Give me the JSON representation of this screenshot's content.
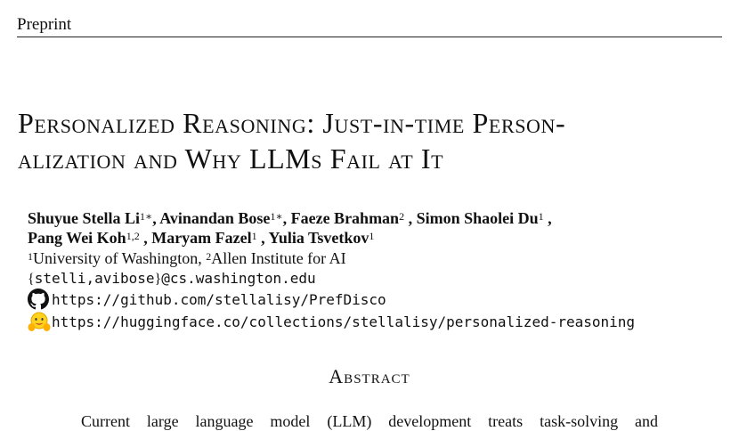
{
  "header": {
    "label": "Preprint"
  },
  "title": {
    "line1": "Personalized Reasoning: Just-in-time Person-",
    "line2": "alization and Why LLMs Fail at It"
  },
  "authors": [
    {
      "name": "Shuyue Stella Li",
      "sup": "1∗",
      "sep": ", "
    },
    {
      "name": "Avinandan Bose",
      "sup": "1∗",
      "sep": ", "
    },
    {
      "name": "Faeze Brahman",
      "sup": "2",
      "sep": " , "
    },
    {
      "name": "Simon Shaolei Du",
      "sup": "1",
      "sep": " ,"
    },
    {
      "name": "Pang Wei Koh",
      "sup": "1,2",
      "sep": " , "
    },
    {
      "name": "Maryam Fazel",
      "sup": "1",
      "sep": " , "
    },
    {
      "name": "Yulia Tsvetkov",
      "sup": "1",
      "sep": ""
    }
  ],
  "affiliations": [
    {
      "sup": "1",
      "name": "University of Washington",
      "sep": ", "
    },
    {
      "sup": "2",
      "name": "Allen Institute for AI",
      "sep": ""
    }
  ],
  "email": {
    "open": "{",
    "users": "stelli,avibose",
    "close": "}",
    "domain": "@cs.washington.edu"
  },
  "links": {
    "github": {
      "url": "https://github.com/stellalisy/PrefDisco",
      "icon": "github-icon"
    },
    "huggingface": {
      "url": "https://huggingface.co/collections/stellalisy/personalized-reasoning",
      "icon": "huggingface-icon"
    }
  },
  "abstract": {
    "heading": "Abstract",
    "first_line": "Current large language model (LLM) development treats task-solving and"
  }
}
